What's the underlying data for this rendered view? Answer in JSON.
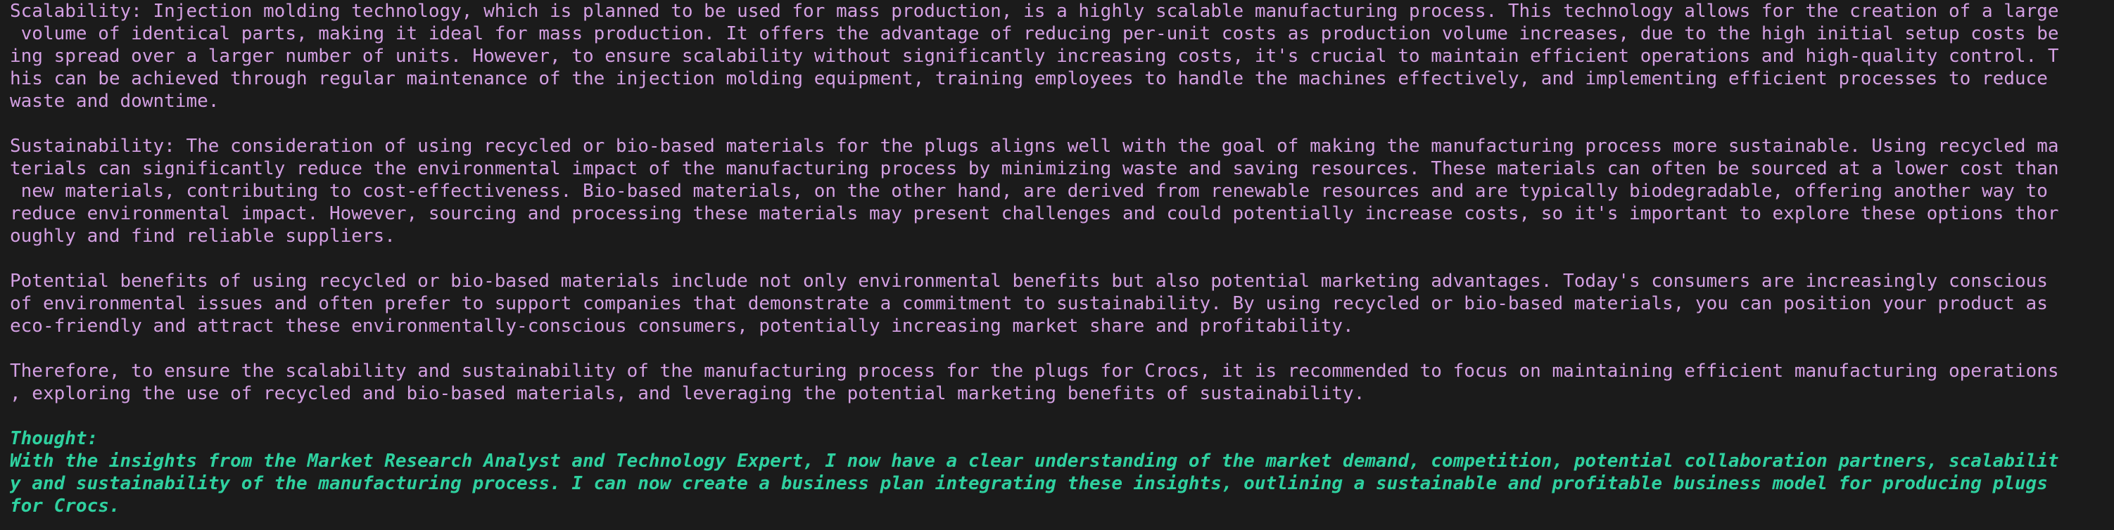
{
  "output_paragraphs": [
    [
      "Scalability: Injection molding technology, which is planned to be used for mass production, is a highly scalable manufacturing process. This technology allows for the creation of a large",
      " volume of identical parts, making it ideal for mass production. It offers the advantage of reducing per-unit costs as production volume increases, due to the high initial setup costs be",
      "ing spread over a larger number of units. However, to ensure scalability without significantly increasing costs, it's crucial to maintain efficient operations and high-quality control. T",
      "his can be achieved through regular maintenance of the injection molding equipment, training employees to handle the machines effectively, and implementing efficient processes to reduce",
      "waste and downtime."
    ],
    [
      "Sustainability: The consideration of using recycled or bio-based materials for the plugs aligns well with the goal of making the manufacturing process more sustainable. Using recycled ma",
      "terials can significantly reduce the environmental impact of the manufacturing process by minimizing waste and saving resources. These materials can often be sourced at a lower cost than",
      " new materials, contributing to cost-effectiveness. Bio-based materials, on the other hand, are derived from renewable resources and are typically biodegradable, offering another way to",
      "reduce environmental impact. However, sourcing and processing these materials may present challenges and could potentially increase costs, so it's important to explore these options thor",
      "oughly and find reliable suppliers."
    ],
    [
      "Potential benefits of using recycled or bio-based materials include not only environmental benefits but also potential marketing advantages. Today's consumers are increasingly conscious",
      "of environmental issues and often prefer to support companies that demonstrate a commitment to sustainability. By using recycled or bio-based materials, you can position your product as",
      "eco-friendly and attract these environmentally-conscious consumers, potentially increasing market share and profitability."
    ],
    [
      "Therefore, to ensure the scalability and sustainability of the manufacturing process for the plugs for Crocs, it is recommended to focus on maintaining efficient manufacturing operations",
      ", exploring the use of recycled and bio-based materials, and leveraging the potential marketing benefits of sustainability."
    ]
  ],
  "thought": {
    "heading": "Thought:",
    "lines": [
      "With the insights from the Market Research Analyst and Technology Expert, I now have a clear understanding of the market demand, competition, potential collaboration partners, scalabilit",
      "y and sustainability of the manufacturing process. I can now create a business plan integrating these insights, outlining a sustainable and profitable business model for producing plugs",
      "for Crocs."
    ]
  },
  "colors": {
    "background": "#1b1b1b",
    "output_text": "#d39fe2",
    "thought_text": "#2fd1a0"
  }
}
